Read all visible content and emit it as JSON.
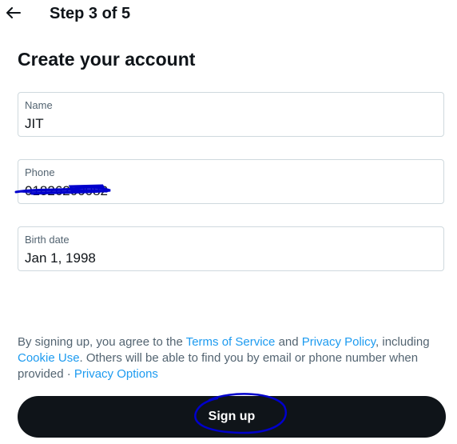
{
  "header": {
    "step_text": "Step 3 of 5",
    "back_icon": "arrow-left-icon"
  },
  "title": "Create your account",
  "fields": [
    {
      "label": "Name",
      "value": "JIT"
    },
    {
      "label": "Phone",
      "value": "01826200082"
    },
    {
      "label": "Birth date",
      "value": "Jan 1, 1998"
    }
  ],
  "legal": {
    "part1": "By signing up, you agree to the ",
    "terms_link": "Terms of Service",
    "part2": " and ",
    "privacy_link": "Privacy Policy",
    "part3": ", including ",
    "cookie_link": "Cookie Use",
    "part4": ". Others will be able to find you by email or phone number when provided · ",
    "privacy_options_link": "Privacy Options"
  },
  "signup_button": {
    "label": "Sign up"
  },
  "colors": {
    "link": "#1d9bf0",
    "button_bg": "#0f1419",
    "annotation": "#0000cc"
  }
}
